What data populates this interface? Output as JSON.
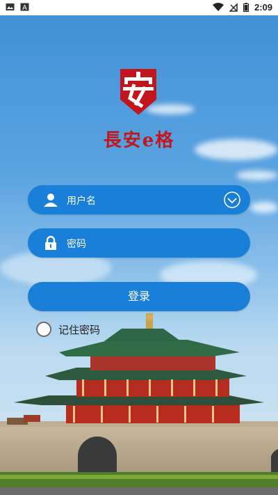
{
  "status_bar": {
    "time": "2:09",
    "left_icons": [
      "image-icon",
      "a-icon"
    ],
    "right_icons": [
      "wifi-icon",
      "no-signal-icon",
      "battery-icon"
    ]
  },
  "app": {
    "name": "長安e格",
    "brand_color": "#c3161c",
    "accent_color": "#1a7fd9"
  },
  "login": {
    "username_placeholder": "用户名",
    "password_placeholder": "密码",
    "login_label": "登录",
    "remember_label": "记住密码",
    "remember_checked": false
  }
}
